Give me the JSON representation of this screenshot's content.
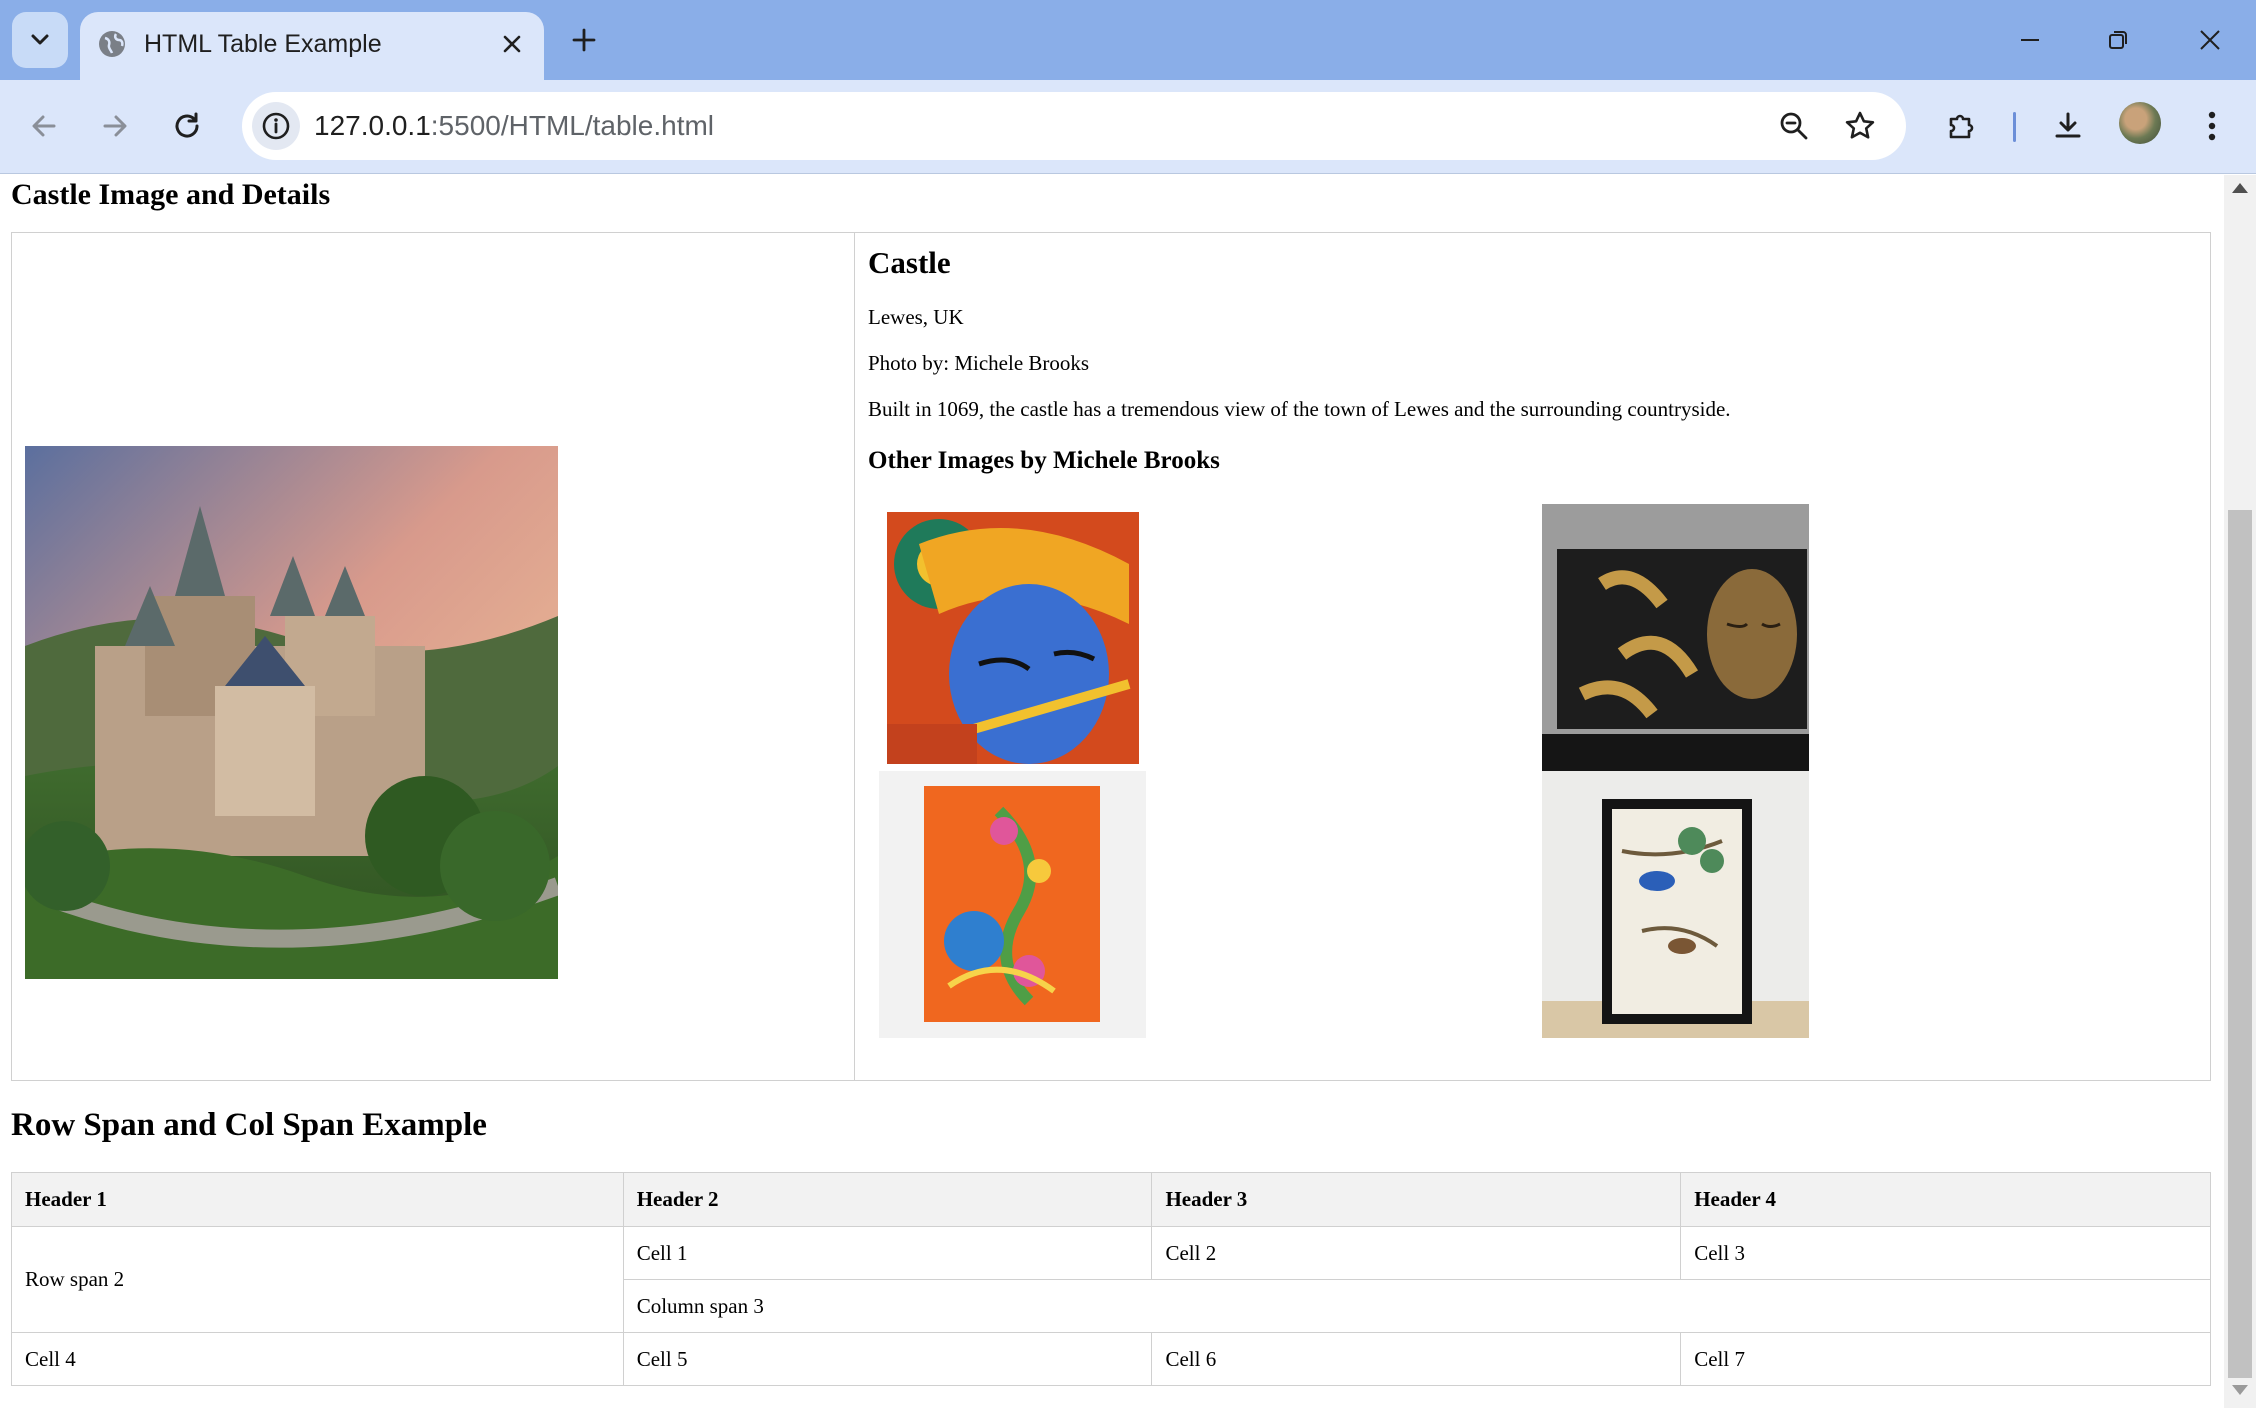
{
  "browser": {
    "tab_title": "HTML Table Example",
    "url_host": "127.0.0.1",
    "url_rest": ":5500/HTML/table.html",
    "colors": {
      "tabbar": "#8aaee8",
      "toolbar": "#dbe6fa"
    }
  },
  "page": {
    "castle_heading": "Castle Image and Details",
    "castle": {
      "title": "Castle",
      "location": "Lewes, UK",
      "photo_credit": "Photo by: Michele Brooks",
      "description": "Built in 1069, the castle has a tremendous view of the town of Lewes and the surrounding countryside.",
      "other_images_heading": "Other Images by Michele Brooks",
      "thumbnails": [
        {
          "name": "krishna-painting"
        },
        {
          "name": "buddha-canvas"
        },
        {
          "name": "peacock-painting"
        },
        {
          "name": "bird-framed-print"
        }
      ]
    },
    "span_heading": "Row Span and Col Span Example",
    "span_table": {
      "headers": [
        "Header 1",
        "Header 2",
        "Header 3",
        "Header 4"
      ],
      "row1": {
        "rowspan_cell": "Row span 2",
        "cells": [
          "Cell 1",
          "Cell 2",
          "Cell 3"
        ]
      },
      "row2": {
        "colspan_cell": "Column span 3"
      },
      "row3": [
        "Cell 4",
        "Cell 5",
        "Cell 6",
        "Cell 7"
      ]
    }
  }
}
